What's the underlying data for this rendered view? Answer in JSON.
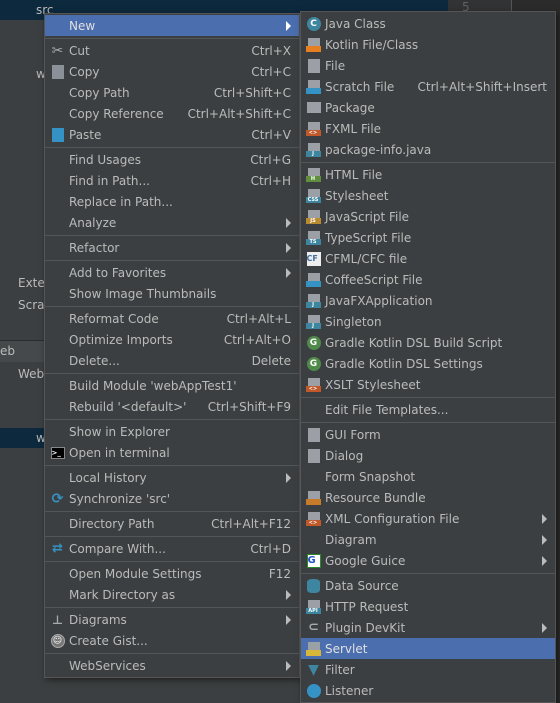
{
  "editor": {
    "line_number": "5"
  },
  "tree": {
    "root": "src",
    "items": [
      "w",
      "Exte",
      "Scra",
      "w",
      "S",
      "w"
    ],
    "tool_window_title": "eb",
    "web_item": "Web"
  },
  "colors": {
    "highlight": "#4b6eaf",
    "menu_bg": "#3c3f41",
    "text": "#bbbbbb",
    "selection": "#0d293e"
  },
  "context_menu": {
    "groups": [
      [
        {
          "label": "New",
          "submenu": true,
          "highlighted": true
        }
      ],
      [
        {
          "label": "Cut",
          "shortcut": "Ctrl+X",
          "icon": "scissors-icon"
        },
        {
          "label": "Copy",
          "shortcut": "Ctrl+C",
          "icon": "copy-icon"
        },
        {
          "label": "Copy Path",
          "shortcut": "Ctrl+Shift+C"
        },
        {
          "label": "Copy Reference",
          "shortcut": "Ctrl+Alt+Shift+C"
        },
        {
          "label": "Paste",
          "shortcut": "Ctrl+V",
          "icon": "paste-icon"
        }
      ],
      [
        {
          "label": "Find Usages",
          "shortcut": "Ctrl+G"
        },
        {
          "label": "Find in Path...",
          "shortcut": "Ctrl+H"
        },
        {
          "label": "Replace in Path..."
        },
        {
          "label": "Analyze",
          "submenu": true
        }
      ],
      [
        {
          "label": "Refactor",
          "submenu": true
        }
      ],
      [
        {
          "label": "Add to Favorites",
          "submenu": true
        },
        {
          "label": "Show Image Thumbnails"
        }
      ],
      [
        {
          "label": "Reformat Code",
          "shortcut": "Ctrl+Alt+L"
        },
        {
          "label": "Optimize Imports",
          "shortcut": "Ctrl+Alt+O"
        },
        {
          "label": "Delete...",
          "shortcut": "Delete"
        }
      ],
      [
        {
          "label": "Build Module 'webAppTest1'"
        },
        {
          "label": "Rebuild '<default>'",
          "shortcut": "Ctrl+Shift+F9"
        }
      ],
      [
        {
          "label": "Show in Explorer"
        },
        {
          "label": "Open in terminal",
          "icon": "terminal-icon"
        }
      ],
      [
        {
          "label": "Local History",
          "submenu": true
        },
        {
          "label": "Synchronize 'src'",
          "icon": "sync-icon"
        }
      ],
      [
        {
          "label": "Directory Path",
          "shortcut": "Ctrl+Alt+F12"
        }
      ],
      [
        {
          "label": "Compare With...",
          "shortcut": "Ctrl+D",
          "icon": "compare-icon"
        }
      ],
      [
        {
          "label": "Open Module Settings",
          "shortcut": "F12"
        },
        {
          "label": "Mark Directory as",
          "submenu": true
        }
      ],
      [
        {
          "label": "Diagrams",
          "submenu": true,
          "icon": "diagram-icon"
        },
        {
          "label": "Create Gist...",
          "icon": "github-icon"
        }
      ],
      [
        {
          "label": "WebServices",
          "submenu": true
        }
      ]
    ]
  },
  "new_submenu": {
    "groups": [
      [
        {
          "label": "Java Class",
          "icon": "java-class-icon"
        },
        {
          "label": "Kotlin File/Class",
          "icon": "kotlin-file-icon"
        },
        {
          "label": "File",
          "icon": "file-icon"
        },
        {
          "label": "Scratch File",
          "shortcut": "Ctrl+Alt+Shift+Insert",
          "icon": "scratch-file-icon"
        },
        {
          "label": "Package",
          "icon": "package-icon"
        },
        {
          "label": "FXML File",
          "icon": "fxml-file-icon"
        },
        {
          "label": "package-info.java",
          "icon": "java-file-icon"
        }
      ],
      [
        {
          "label": "HTML File",
          "icon": "html-file-icon"
        },
        {
          "label": "Stylesheet",
          "icon": "css-file-icon"
        },
        {
          "label": "JavaScript File",
          "icon": "js-file-icon"
        },
        {
          "label": "TypeScript File",
          "icon": "ts-file-icon"
        },
        {
          "label": "CFML/CFC file",
          "icon": "cfml-icon"
        },
        {
          "label": "CoffeeScript File",
          "icon": "coffeescript-icon"
        },
        {
          "label": "JavaFXApplication",
          "icon": "java-file-icon"
        },
        {
          "label": "Singleton",
          "icon": "java-file-icon"
        },
        {
          "label": "Gradle Kotlin DSL Build Script",
          "icon": "gradle-icon"
        },
        {
          "label": "Gradle Kotlin DSL Settings",
          "icon": "gradle-icon"
        },
        {
          "label": "XSLT Stylesheet",
          "icon": "xslt-file-icon"
        }
      ],
      [
        {
          "label": "Edit File Templates..."
        }
      ],
      [
        {
          "label": "GUI Form",
          "icon": "gui-form-icon"
        },
        {
          "label": "Dialog",
          "icon": "dialog-icon"
        },
        {
          "label": "Form Snapshot"
        },
        {
          "label": "Resource Bundle",
          "icon": "resource-bundle-icon"
        },
        {
          "label": "XML Configuration File",
          "submenu": true,
          "icon": "xml-file-icon"
        },
        {
          "label": "Diagram",
          "submenu": true
        },
        {
          "label": "Google Guice",
          "submenu": true,
          "icon": "google-guice-icon"
        }
      ],
      [
        {
          "label": "Data Source",
          "icon": "database-icon"
        },
        {
          "label": "HTTP Request",
          "icon": "http-request-icon"
        },
        {
          "label": "Plugin DevKit",
          "submenu": true,
          "icon": "plugin-icon"
        },
        {
          "label": "Servlet",
          "icon": "servlet-icon",
          "highlighted": true
        },
        {
          "label": "Filter",
          "icon": "filter-icon"
        },
        {
          "label": "Listener",
          "icon": "listener-icon"
        }
      ]
    ]
  }
}
